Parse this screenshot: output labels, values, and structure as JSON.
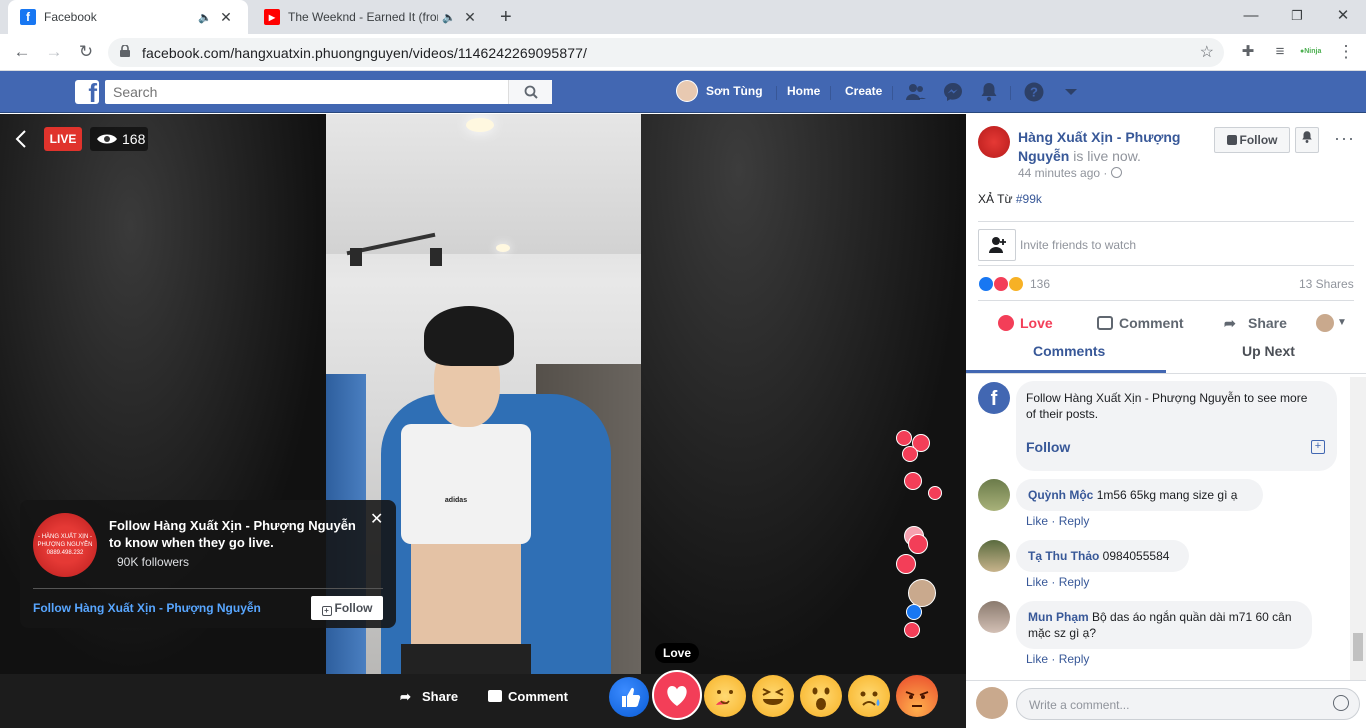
{
  "browser": {
    "tabs": [
      {
        "title": "Facebook",
        "active": true
      },
      {
        "title": "The Weeknd - Earned It (from",
        "active": false
      }
    ],
    "url": "facebook.com/hangxuatxin.phuongnguyen/videos/1146242269095877/"
  },
  "fb": {
    "search_placeholder": "Search",
    "user_name": "Sơn Tùng",
    "nav_home": "Home",
    "nav_create": "Create"
  },
  "video": {
    "live_label": "LIVE",
    "viewer_count": "168",
    "popup": {
      "message": "Follow Hàng Xuất Xịn - Phượng Nguyễn to know when they go live.",
      "followers": "90K followers",
      "link": "Follow Hàng Xuất Xịn - Phượng Nguyễn",
      "follow_button": "Follow",
      "avatar_text": "- HÀNG XUẤT XỊN - PHƯỢNG NGUYỄN 0889.498.232"
    },
    "share_label": "Share",
    "comment_label": "Comment",
    "love_tooltip": "Love"
  },
  "panel": {
    "page_name": "Hàng Xuất Xịn - Phượng Nguyễn",
    "status": "is live now.",
    "time": "44 minutes ago",
    "follow_button": "Follow",
    "post_text_prefix": "XẢ Từ",
    "post_hashtag": "#99k",
    "invite_text": "Invite friends to watch",
    "reaction_count": "136",
    "shares": "13 Shares",
    "love_label": "Love",
    "comment_label": "Comment",
    "share_label": "Share",
    "tab_comments": "Comments",
    "tab_upnext": "Up Next",
    "follow_card_text": "Follow Hàng Xuất Xịn - Phượng Nguyễn to see more of their posts.",
    "follow_card_link": "Follow",
    "comments": [
      {
        "name": "Quỳnh Mộc",
        "text": "1m56 65kg mang size gì ạ",
        "like": "Like",
        "reply": "Reply"
      },
      {
        "name": "Tạ Thu Thảo",
        "text": "0984055584",
        "like": "Like",
        "reply": "Reply"
      },
      {
        "name": "Mun Phạm",
        "text": "Bộ das áo ngắn quần dài m71 60 cân mặc sz gì ạ?",
        "like": "Like",
        "reply": "Reply"
      }
    ],
    "write_placeholder": "Write a comment..."
  },
  "colors": {
    "fb_blue": "#4267b2",
    "live_red": "#e0332c",
    "link_blue": "#385898"
  }
}
